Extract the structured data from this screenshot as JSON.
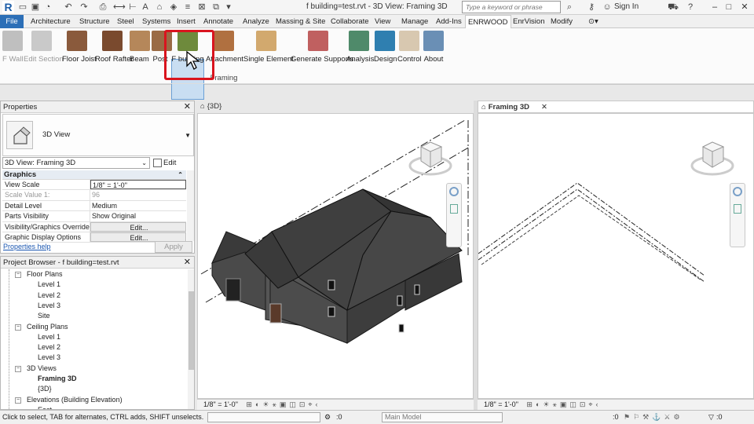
{
  "titlebar": {
    "title": "f building=test.rvt - 3D View: Framing 3D",
    "search_placeholder": "Type a keyword or phrase",
    "signin": "Sign In"
  },
  "tabs": [
    "File",
    "Architecture",
    "Structure",
    "Steel",
    "Systems",
    "Insert",
    "Annotate",
    "Analyze",
    "Massing & Site",
    "Collaborate",
    "View",
    "Manage",
    "Add-Ins",
    "ENRWOOD",
    "EnrVision",
    "Modify"
  ],
  "active_tab": "ENRWOOD",
  "ribbon": {
    "buttons": [
      {
        "label": "F Wall",
        "disabled": true,
        "color": "#bfbfbf"
      },
      {
        "label": "Edit Section",
        "disabled": true,
        "color": "#c9c9c9"
      },
      {
        "label": "Floor Joist",
        "disabled": false,
        "color": "#8a5a3c"
      },
      {
        "label": "Roof Rafter",
        "disabled": false,
        "color": "#7a4a2e"
      },
      {
        "label": "Beam",
        "disabled": false,
        "color": "#b5875a"
      },
      {
        "label": "Post",
        "disabled": false,
        "color": "#9a6b45"
      },
      {
        "label": "F building",
        "disabled": false,
        "color": "#6e8a3c"
      },
      {
        "label": "Attachment",
        "disabled": false,
        "color": "#b07040"
      },
      {
        "label": "Single Element",
        "disabled": false,
        "color": "#d2a96e"
      },
      {
        "label": "Generate Supports",
        "disabled": false,
        "color": "#c06060"
      },
      {
        "label": "Analysis",
        "disabled": false,
        "color": "#4f8a6a"
      },
      {
        "label": "Design",
        "disabled": false,
        "color": "#2f7fb0"
      },
      {
        "label": "Control",
        "disabled": false,
        "color": "#d8c8b0"
      },
      {
        "label": "About",
        "disabled": false,
        "color": "#6a8fb5"
      }
    ],
    "panel_label": "Framing"
  },
  "properties": {
    "header": "Properties",
    "type_name": "3D View",
    "view_filter": "3D View: Framing 3D",
    "edit_type": "Edit Type",
    "group": "Graphics",
    "rows": [
      {
        "key": "View Scale",
        "value": "1/8\" = 1'-0\"",
        "style": "edit"
      },
      {
        "key": "Scale Value    1:",
        "value": "96",
        "style": "ro"
      },
      {
        "key": "Detail Level",
        "value": "Medium",
        "style": ""
      },
      {
        "key": "Parts Visibility",
        "value": "Show Original",
        "style": ""
      },
      {
        "key": "Visibility/Graphics Overrides",
        "value": "Edit...",
        "style": "btn"
      },
      {
        "key": "Graphic Display Options",
        "value": "Edit...",
        "style": "btn"
      }
    ],
    "help_link": "Properties help",
    "apply": "Apply"
  },
  "browser": {
    "header": "Project Browser - f building=test.rvt",
    "items": [
      {
        "label": "Floor Plans",
        "level": 1,
        "bold": false
      },
      {
        "label": "Level 1",
        "level": 2,
        "bold": false
      },
      {
        "label": "Level 2",
        "level": 2,
        "bold": false
      },
      {
        "label": "Level 3",
        "level": 2,
        "bold": false
      },
      {
        "label": "Site",
        "level": 2,
        "bold": false
      },
      {
        "label": "Ceiling Plans",
        "level": 1,
        "bold": false
      },
      {
        "label": "Level 1",
        "level": 2,
        "bold": false
      },
      {
        "label": "Level 2",
        "level": 2,
        "bold": false
      },
      {
        "label": "Level 3",
        "level": 2,
        "bold": false
      },
      {
        "label": "3D Views",
        "level": 1,
        "bold": false
      },
      {
        "label": "Framing 3D",
        "level": 2,
        "bold": true
      },
      {
        "label": "{3D}",
        "level": 2,
        "bold": false
      },
      {
        "label": "Elevations (Building Elevation)",
        "level": 1,
        "bold": false
      },
      {
        "label": "East",
        "level": 2,
        "bold": false
      }
    ]
  },
  "views": {
    "left_tab": "{3D}",
    "right_tab": "Framing 3D",
    "left_scale": "1/8\" = 1'-0\"",
    "right_scale": "1/8\" = 1'-0\""
  },
  "status": {
    "hint": "Click to select, TAB for alternates, CTRL adds, SHIFT unselects.",
    "count1": ":0",
    "model": "Main Model",
    "count2": ":0",
    "filter_count": ":0"
  },
  "colors": {
    "file_tab": "#2c6fb7",
    "highlight": "#d9141e",
    "building": "#3b3b3b"
  }
}
